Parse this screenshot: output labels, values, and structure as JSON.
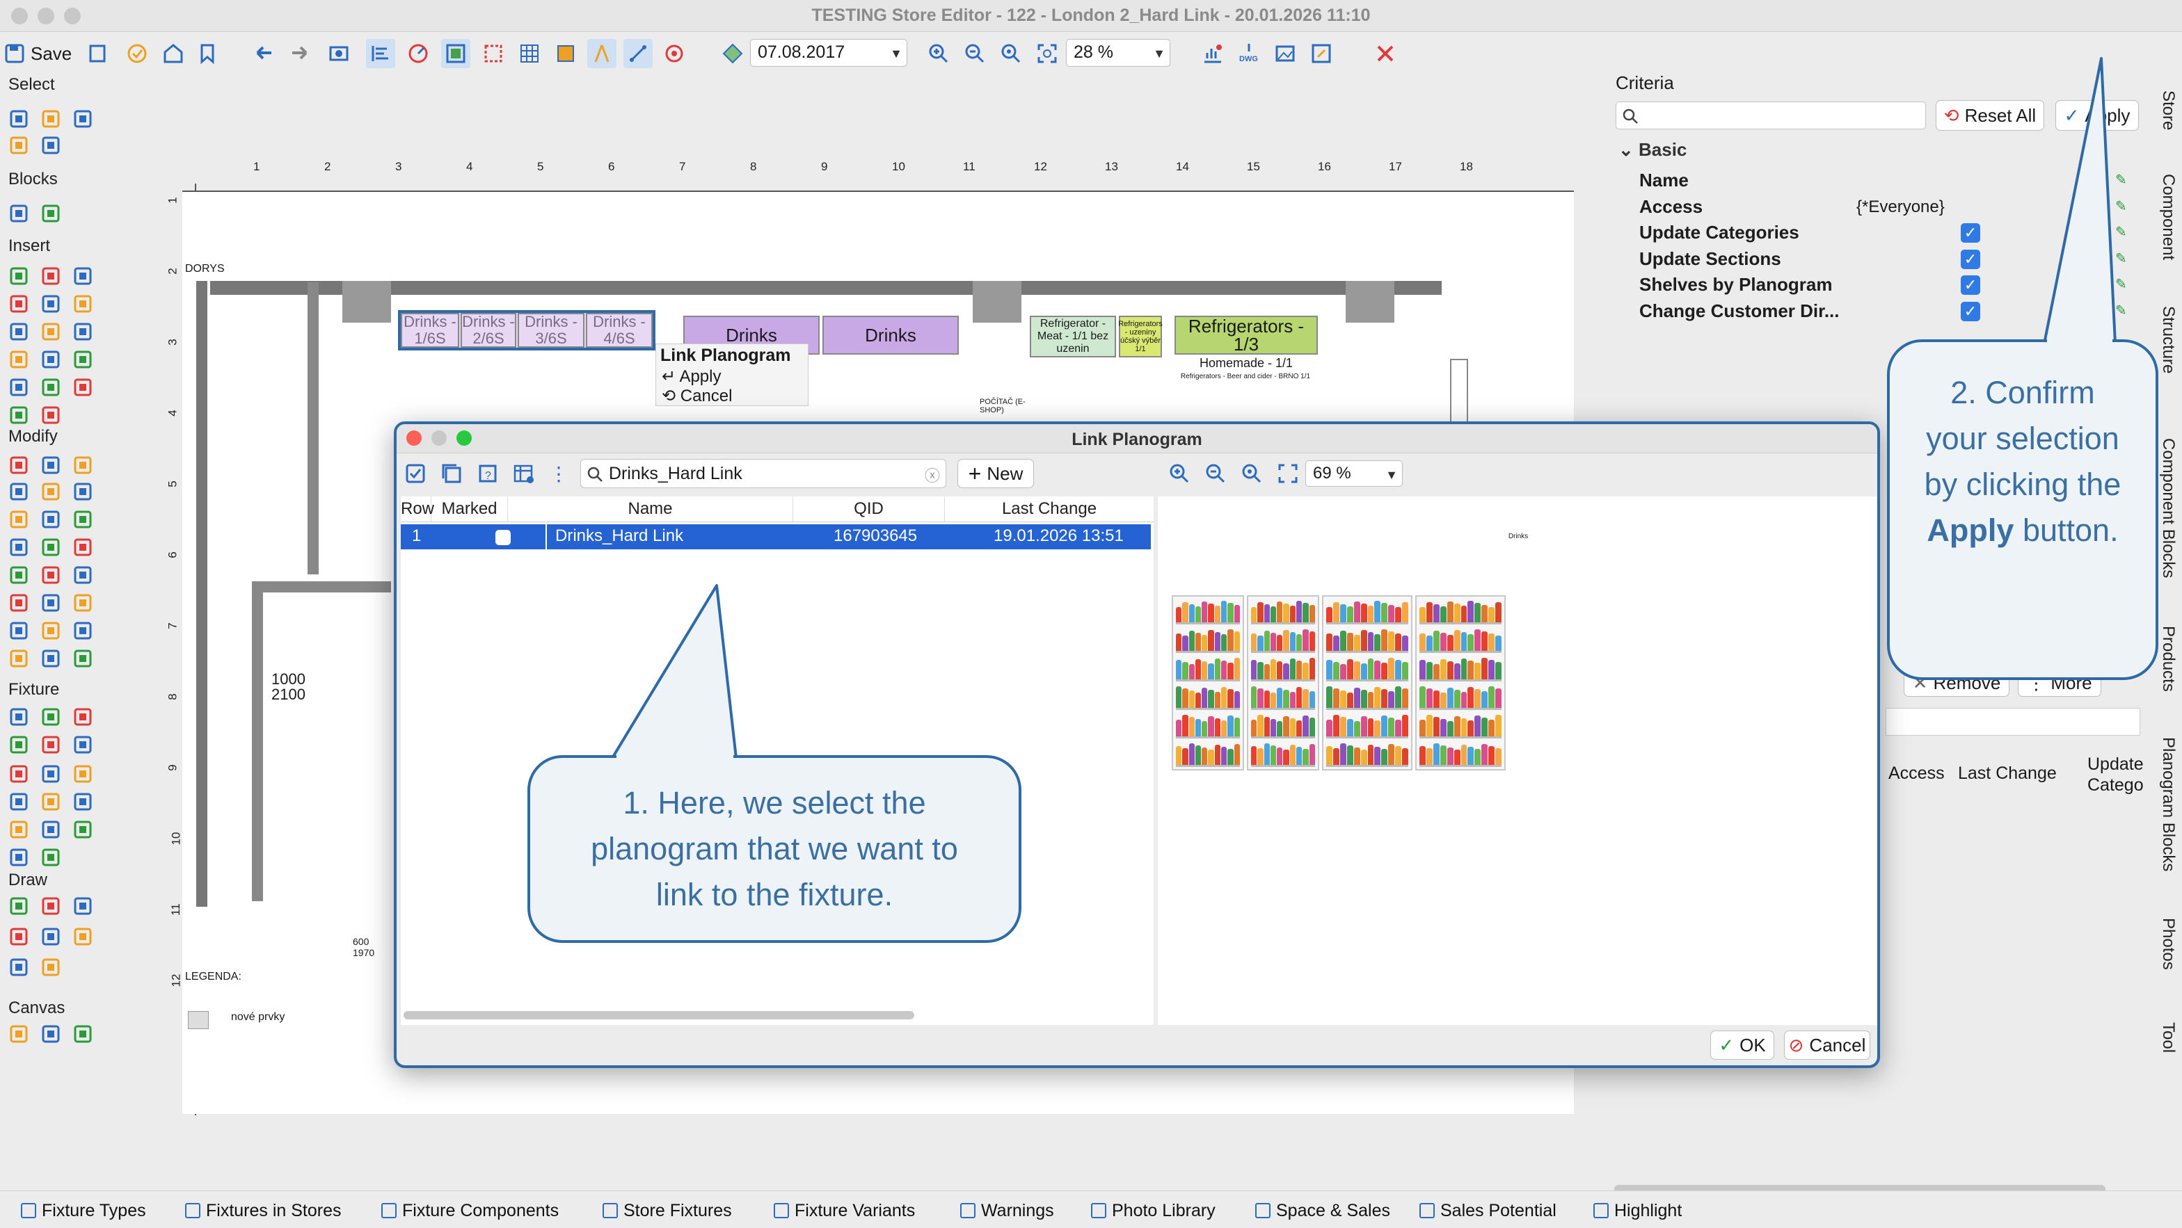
{
  "window": {
    "title": "TESTING Store Editor - 122 - London 2_Hard Link - 20.01.2026 11:10"
  },
  "toolbar": {
    "save_label": "Save",
    "date_value": "07.08.2017",
    "zoom_value": "28 %"
  },
  "left_panel": {
    "groups": [
      "Select",
      "Blocks",
      "Insert",
      "Modify",
      "Fixture",
      "Draw",
      "Canvas"
    ]
  },
  "canvas": {
    "ruler_x": [
      "1",
      "2",
      "3",
      "4",
      "5",
      "6",
      "7",
      "8",
      "9",
      "10",
      "11",
      "12",
      "13",
      "14",
      "15",
      "16",
      "17",
      "18"
    ],
    "ruler_y": [
      "1",
      "2",
      "3",
      "4",
      "5",
      "6",
      "7",
      "8",
      "9",
      "10",
      "11",
      "12"
    ],
    "fixtures": {
      "drinks1": "Drinks - 1/6S",
      "drinks2": "Drinks - 2/6S",
      "drinks3": "Drinks - 3/6S",
      "drinks4": "Drinks - 4/6S",
      "drinks5": "Drinks",
      "drinks6": "Drinks",
      "fridge_meat": "Refrigerator - Meat - 1/1 bez uzenin",
      "fridge_small": "Refrigerators - uzeniny účský výběr 1/1",
      "fridges": "Refrigerators - 1/3",
      "homemade": "Homemade - 1/1",
      "homemade_sub": "Refrigerators - Beer and cider - BRNO 1/1",
      "pocitac": "POČÍTAČ (E-SHOP)",
      "label_dorys": "DORYS",
      "label_1000": "1000",
      "label_2100": "2100",
      "label_600": "600",
      "label_1970": "1970",
      "label_legenda": "LEGENDA:",
      "label_nove": "nové prvky"
    },
    "context_menu": {
      "title": "Link Planogram",
      "apply": "Apply",
      "cancel": "Cancel"
    }
  },
  "right_panel": {
    "criteria_label": "Criteria",
    "reset_all": "Reset All",
    "apply": "Apply",
    "section": "Basic",
    "props": [
      {
        "label": "Name",
        "value": "",
        "checked": false
      },
      {
        "label": "Access",
        "value": "{*Everyone}",
        "checked": false
      },
      {
        "label": "Update Categories",
        "value": "",
        "checked": true
      },
      {
        "label": "Update Sections",
        "value": "",
        "checked": true
      },
      {
        "label": "Shelves by Planogram",
        "value": "",
        "checked": true
      },
      {
        "label": "Change Customer Dir...",
        "value": "",
        "checked": true
      }
    ],
    "remove": "Remove",
    "more": "More",
    "col_access": "Access",
    "col_last_change": "Last Change",
    "col_update_cat": "Update Catego"
  },
  "side_tabs": [
    "Store",
    "Component",
    "Structure",
    "Component Blocks",
    "Products",
    "Planogram Blocks",
    "Photos",
    "Tool"
  ],
  "bottom_tabs": [
    "Fixture Types",
    "Fixtures in Stores",
    "Fixture Components",
    "Store Fixtures",
    "Fixture Variants",
    "Warnings",
    "Photo Library",
    "Space & Sales",
    "Sales Potential",
    "Highlight"
  ],
  "dialog": {
    "title": "Link Planogram",
    "search_value": "Drinks_Hard Link",
    "new_label": "New",
    "columns": [
      "Row",
      "Marked",
      "Name",
      "QID",
      "Last Change"
    ],
    "rows": [
      {
        "row": "1",
        "marked": false,
        "name": "Drinks_Hard Link",
        "qid": "167903645",
        "last_change": "19.01.2026 13:51"
      }
    ],
    "preview_zoom": "69 %",
    "preview_title": "Drinks",
    "ok_label": "OK",
    "cancel_label": "Cancel"
  },
  "callouts": {
    "one": "1. Here, we select the planogram that we want to link to the fixture.",
    "two_pre": "2. Confirm your selection by clicking the",
    "two_bold": "Apply",
    "two_post": "button."
  },
  "colors": {
    "accent": "#2e6aa8",
    "selection": "#2563d4",
    "fixture_purple": "#c9a8e6",
    "fixture_green": "#b7d66f",
    "check": "#2f7ae5"
  }
}
